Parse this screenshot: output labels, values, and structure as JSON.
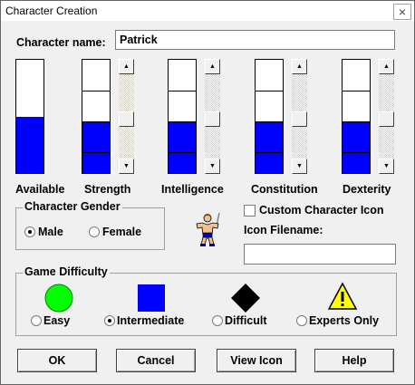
{
  "window": {
    "title": "Character Creation",
    "close_glyph": "×"
  },
  "name": {
    "label": "Character name:",
    "value": "Patrick"
  },
  "stats": [
    {
      "label": "Available",
      "fraction": 0.5,
      "segments": 0
    },
    {
      "label": "Strength",
      "fraction": 0.45,
      "segments": 4
    },
    {
      "label": "Intelligence",
      "fraction": 0.45,
      "segments": 4
    },
    {
      "label": "Constitution",
      "fraction": 0.45,
      "segments": 4
    },
    {
      "label": "Dexterity",
      "fraction": 0.45,
      "segments": 4
    }
  ],
  "gender": {
    "legend": "Character Gender",
    "options": [
      "Male",
      "Female"
    ],
    "selected": "Male"
  },
  "icon": {
    "custom_label": "Custom Character Icon",
    "filename_label": "Icon Filename:",
    "filename_value": ""
  },
  "difficulty": {
    "legend": "Game Difficulty",
    "options": [
      {
        "label": "Easy",
        "icon": "green-circle"
      },
      {
        "label": "Intermediate",
        "icon": "blue-square"
      },
      {
        "label": "Difficult",
        "icon": "black-diamond"
      },
      {
        "label": "Experts Only",
        "icon": "warning-triangle"
      }
    ],
    "selected": "Intermediate"
  },
  "buttons": {
    "ok": "OK",
    "cancel": "Cancel",
    "view_icon": "View Icon",
    "help": "Help"
  },
  "colors": {
    "bar_fill": "#0000ff",
    "easy": "#00ff00",
    "intermediate": "#0000ff",
    "difficult": "#000000",
    "warning": "#ffff00"
  }
}
